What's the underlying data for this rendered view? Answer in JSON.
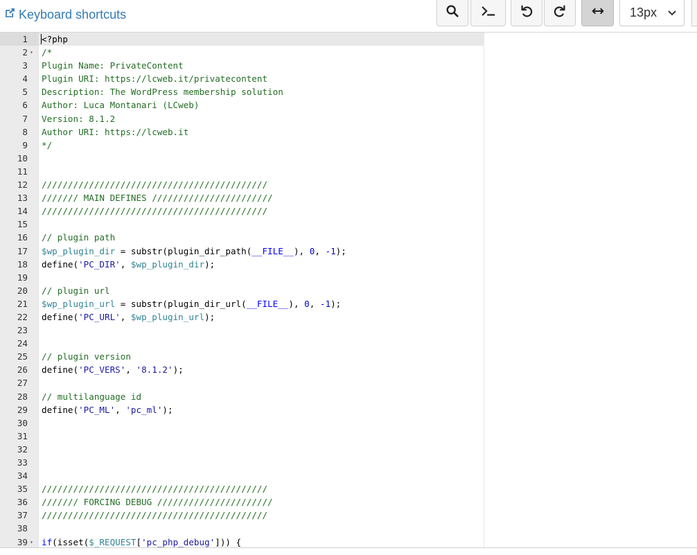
{
  "toolbar": {
    "shortcuts_label": "Keyboard shortcuts",
    "zoom_value": "13px",
    "buttons": [
      "search-icon",
      "terminal-icon",
      "undo-icon",
      "redo-icon",
      "wrap-icon"
    ]
  },
  "editor": {
    "lines": [
      {
        "n": "1",
        "fold": "",
        "code": [
          {
            "t": "plain",
            "v": "<?php"
          }
        ]
      },
      {
        "n": "2",
        "fold": "▾",
        "code": [
          {
            "t": "comment",
            "v": "/*"
          }
        ]
      },
      {
        "n": "3",
        "fold": "",
        "code": [
          {
            "t": "comment",
            "v": "Plugin Name: PrivateContent"
          }
        ]
      },
      {
        "n": "4",
        "fold": "",
        "code": [
          {
            "t": "comment",
            "v": "Plugin URI: https://lcweb.it/privatecontent"
          }
        ]
      },
      {
        "n": "5",
        "fold": "",
        "code": [
          {
            "t": "comment",
            "v": "Description: The WordPress membership solution"
          }
        ]
      },
      {
        "n": "6",
        "fold": "",
        "code": [
          {
            "t": "comment",
            "v": "Author: Luca Montanari (LCweb)"
          }
        ]
      },
      {
        "n": "7",
        "fold": "",
        "code": [
          {
            "t": "comment",
            "v": "Version: 8.1.2"
          }
        ]
      },
      {
        "n": "8",
        "fold": "",
        "code": [
          {
            "t": "comment",
            "v": "Author URI: https://lcweb.it"
          }
        ]
      },
      {
        "n": "9",
        "fold": "",
        "code": [
          {
            "t": "comment",
            "v": "*/"
          }
        ]
      },
      {
        "n": "10",
        "fold": "",
        "code": []
      },
      {
        "n": "11",
        "fold": "",
        "code": []
      },
      {
        "n": "12",
        "fold": "",
        "code": [
          {
            "t": "comment",
            "v": "///////////////////////////////////////////"
          }
        ]
      },
      {
        "n": "13",
        "fold": "",
        "code": [
          {
            "t": "comment",
            "v": "/////// MAIN DEFINES ///////////////////////"
          }
        ]
      },
      {
        "n": "14",
        "fold": "",
        "code": [
          {
            "t": "comment",
            "v": "///////////////////////////////////////////"
          }
        ]
      },
      {
        "n": "15",
        "fold": "",
        "code": []
      },
      {
        "n": "16",
        "fold": "",
        "code": [
          {
            "t": "comment",
            "v": "// plugin path"
          }
        ]
      },
      {
        "n": "17",
        "fold": "",
        "code": [
          {
            "t": "var",
            "v": "$wp_plugin_dir"
          },
          {
            "t": "plain",
            "v": " = substr(plugin_dir_path("
          },
          {
            "t": "kw",
            "v": "__FILE__"
          },
          {
            "t": "plain",
            "v": "), "
          },
          {
            "t": "num",
            "v": "0"
          },
          {
            "t": "plain",
            "v": ", "
          },
          {
            "t": "num",
            "v": "-1"
          },
          {
            "t": "plain",
            "v": ");"
          }
        ]
      },
      {
        "n": "18",
        "fold": "",
        "code": [
          {
            "t": "plain",
            "v": "define("
          },
          {
            "t": "str",
            "v": "'PC_DIR'"
          },
          {
            "t": "plain",
            "v": ", "
          },
          {
            "t": "var",
            "v": "$wp_plugin_dir"
          },
          {
            "t": "plain",
            "v": ");"
          }
        ]
      },
      {
        "n": "19",
        "fold": "",
        "code": []
      },
      {
        "n": "20",
        "fold": "",
        "code": [
          {
            "t": "comment",
            "v": "// plugin url"
          }
        ]
      },
      {
        "n": "21",
        "fold": "",
        "code": [
          {
            "t": "var",
            "v": "$wp_plugin_url"
          },
          {
            "t": "plain",
            "v": " = substr(plugin_dir_url("
          },
          {
            "t": "kw",
            "v": "__FILE__"
          },
          {
            "t": "plain",
            "v": "), "
          },
          {
            "t": "num",
            "v": "0"
          },
          {
            "t": "plain",
            "v": ", "
          },
          {
            "t": "num",
            "v": "-1"
          },
          {
            "t": "plain",
            "v": ");"
          }
        ]
      },
      {
        "n": "22",
        "fold": "",
        "code": [
          {
            "t": "plain",
            "v": "define("
          },
          {
            "t": "str",
            "v": "'PC_URL'"
          },
          {
            "t": "plain",
            "v": ", "
          },
          {
            "t": "var",
            "v": "$wp_plugin_url"
          },
          {
            "t": "plain",
            "v": ");"
          }
        ]
      },
      {
        "n": "23",
        "fold": "",
        "code": []
      },
      {
        "n": "24",
        "fold": "",
        "code": []
      },
      {
        "n": "25",
        "fold": "",
        "code": [
          {
            "t": "comment",
            "v": "// plugin version"
          }
        ]
      },
      {
        "n": "26",
        "fold": "",
        "code": [
          {
            "t": "plain",
            "v": "define("
          },
          {
            "t": "str",
            "v": "'PC_VERS'"
          },
          {
            "t": "plain",
            "v": ", "
          },
          {
            "t": "str",
            "v": "'8.1.2'"
          },
          {
            "t": "plain",
            "v": ");"
          }
        ]
      },
      {
        "n": "27",
        "fold": "",
        "code": []
      },
      {
        "n": "28",
        "fold": "",
        "code": [
          {
            "t": "comment",
            "v": "// multilanguage id"
          }
        ]
      },
      {
        "n": "29",
        "fold": "",
        "code": [
          {
            "t": "plain",
            "v": "define("
          },
          {
            "t": "str",
            "v": "'PC_ML'"
          },
          {
            "t": "plain",
            "v": ", "
          },
          {
            "t": "str",
            "v": "'pc_ml'"
          },
          {
            "t": "plain",
            "v": ");"
          }
        ]
      },
      {
        "n": "30",
        "fold": "",
        "code": []
      },
      {
        "n": "31",
        "fold": "",
        "code": []
      },
      {
        "n": "32",
        "fold": "",
        "code": []
      },
      {
        "n": "33",
        "fold": "",
        "code": []
      },
      {
        "n": "34",
        "fold": "",
        "code": []
      },
      {
        "n": "35",
        "fold": "",
        "code": [
          {
            "t": "comment",
            "v": "///////////////////////////////////////////"
          }
        ]
      },
      {
        "n": "36",
        "fold": "",
        "code": [
          {
            "t": "comment",
            "v": "/////// FORCING DEBUG //////////////////////"
          }
        ]
      },
      {
        "n": "37",
        "fold": "",
        "code": [
          {
            "t": "comment",
            "v": "///////////////////////////////////////////"
          }
        ]
      },
      {
        "n": "38",
        "fold": "",
        "code": []
      },
      {
        "n": "39",
        "fold": "▾",
        "code": [
          {
            "t": "kw",
            "v": "if"
          },
          {
            "t": "plain",
            "v": "(isset("
          },
          {
            "t": "var",
            "v": "$_REQUEST"
          },
          {
            "t": "plain",
            "v": "["
          },
          {
            "t": "str",
            "v": "'pc_php_debug'"
          },
          {
            "t": "plain",
            "v": "])) {"
          }
        ]
      }
    ]
  }
}
